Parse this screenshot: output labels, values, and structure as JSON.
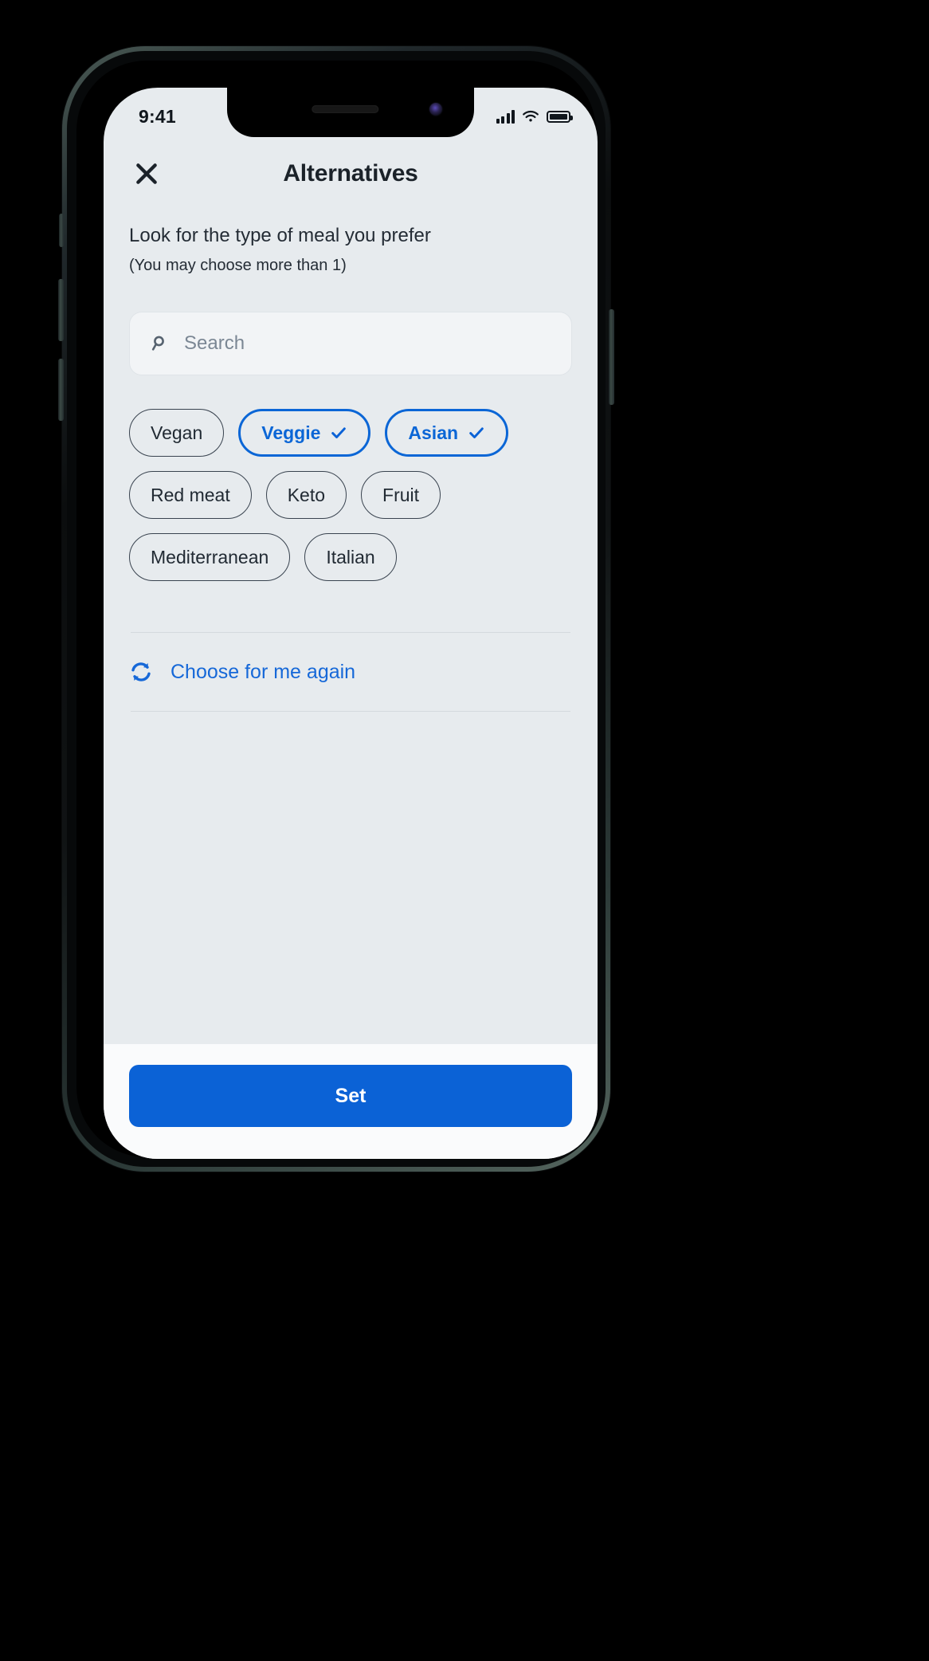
{
  "status_bar": {
    "time": "9:41",
    "signal_icon": "cellular-bars-icon",
    "wifi_icon": "wifi-icon",
    "battery_icon": "battery-full-icon"
  },
  "header": {
    "close_icon": "close-icon",
    "title": "Alternatives"
  },
  "intro": {
    "line1": "Look for the type of meal you prefer",
    "line2": "(You may choose more than 1)"
  },
  "search": {
    "icon": "search-icon",
    "placeholder": "Search",
    "value": ""
  },
  "chips": [
    {
      "label": "Vegan",
      "selected": false
    },
    {
      "label": "Veggie",
      "selected": true
    },
    {
      "label": "Asian",
      "selected": true
    },
    {
      "label": "Red meat",
      "selected": false
    },
    {
      "label": "Keto",
      "selected": false
    },
    {
      "label": "Fruit",
      "selected": false
    },
    {
      "label": "Mediterranean",
      "selected": false
    },
    {
      "label": "Italian",
      "selected": false
    }
  ],
  "redo": {
    "icon": "refresh-icon",
    "label": "Choose for me again"
  },
  "footer": {
    "primary_label": "Set"
  },
  "colors": {
    "accent": "#0b62d6",
    "screen_bg": "#e7ebee",
    "chip_border": "#39434f",
    "text": "#1b2229",
    "placeholder": "#7b8794",
    "footer_bg": "#fafbfc"
  }
}
